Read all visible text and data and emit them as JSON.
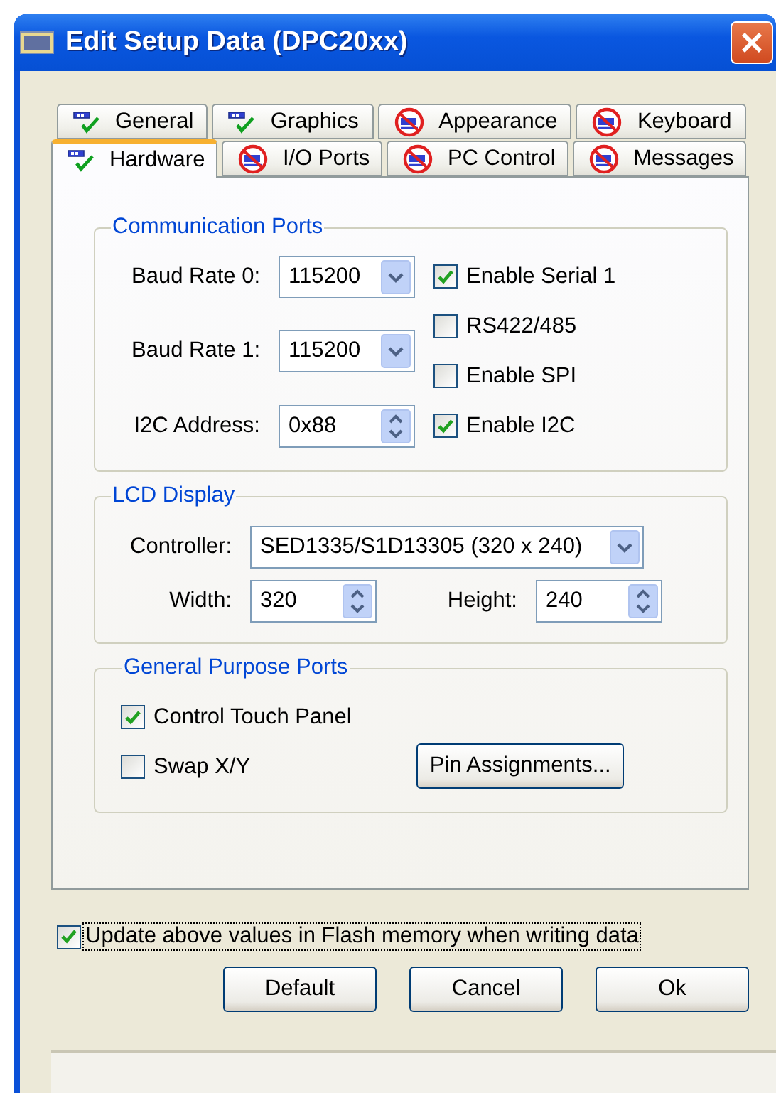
{
  "window": {
    "title": "Edit Setup Data (DPC20xx)"
  },
  "tab_rows": [
    [
      {
        "label": "General",
        "kind": "ok",
        "selected": false
      },
      {
        "label": "Graphics",
        "kind": "ok",
        "selected": false
      },
      {
        "label": "Appearance",
        "kind": "blocked",
        "selected": false
      },
      {
        "label": "Keyboard",
        "kind": "blocked",
        "selected": false
      }
    ],
    [
      {
        "label": "Hardware",
        "kind": "ok",
        "selected": true
      },
      {
        "label": "I/O Ports",
        "kind": "blocked",
        "selected": false
      },
      {
        "label": "PC Control",
        "kind": "blocked",
        "selected": false
      },
      {
        "label": "Messages",
        "kind": "blocked",
        "selected": false
      }
    ]
  ],
  "communication_ports": {
    "title": "Communication Ports",
    "fields": [
      {
        "label": "Baud Rate 0:",
        "kind": "combo",
        "value": "115200"
      },
      {
        "label": "Baud Rate 1:",
        "kind": "combo",
        "value": "115200"
      },
      {
        "label": "I2C Address:",
        "kind": "spin",
        "value": "0x88"
      }
    ],
    "options": [
      {
        "label": "Enable Serial 1",
        "checked": true
      },
      {
        "label": "RS422/485",
        "checked": false
      },
      {
        "label": "Enable SPI",
        "checked": false
      },
      {
        "label": "Enable I2C",
        "checked": true
      }
    ]
  },
  "lcd_display": {
    "title": "LCD Display",
    "controller": {
      "label": "Controller:",
      "value": "SED1335/S1D13305 (320 x 240)"
    },
    "width": {
      "label": "Width:",
      "value": "320"
    },
    "height": {
      "label": "Height:",
      "value": "240"
    }
  },
  "general_purpose_ports": {
    "title": "General Purpose Ports",
    "options": [
      {
        "label": "Control Touch Panel",
        "checked": true
      },
      {
        "label": "Swap X/Y",
        "checked": false
      }
    ],
    "button": "Pin Assignments..."
  },
  "update_flash": {
    "label": "Update above values in Flash memory when writing data",
    "checked": true
  },
  "buttons": [
    "Default",
    "Cancel",
    "Ok"
  ]
}
